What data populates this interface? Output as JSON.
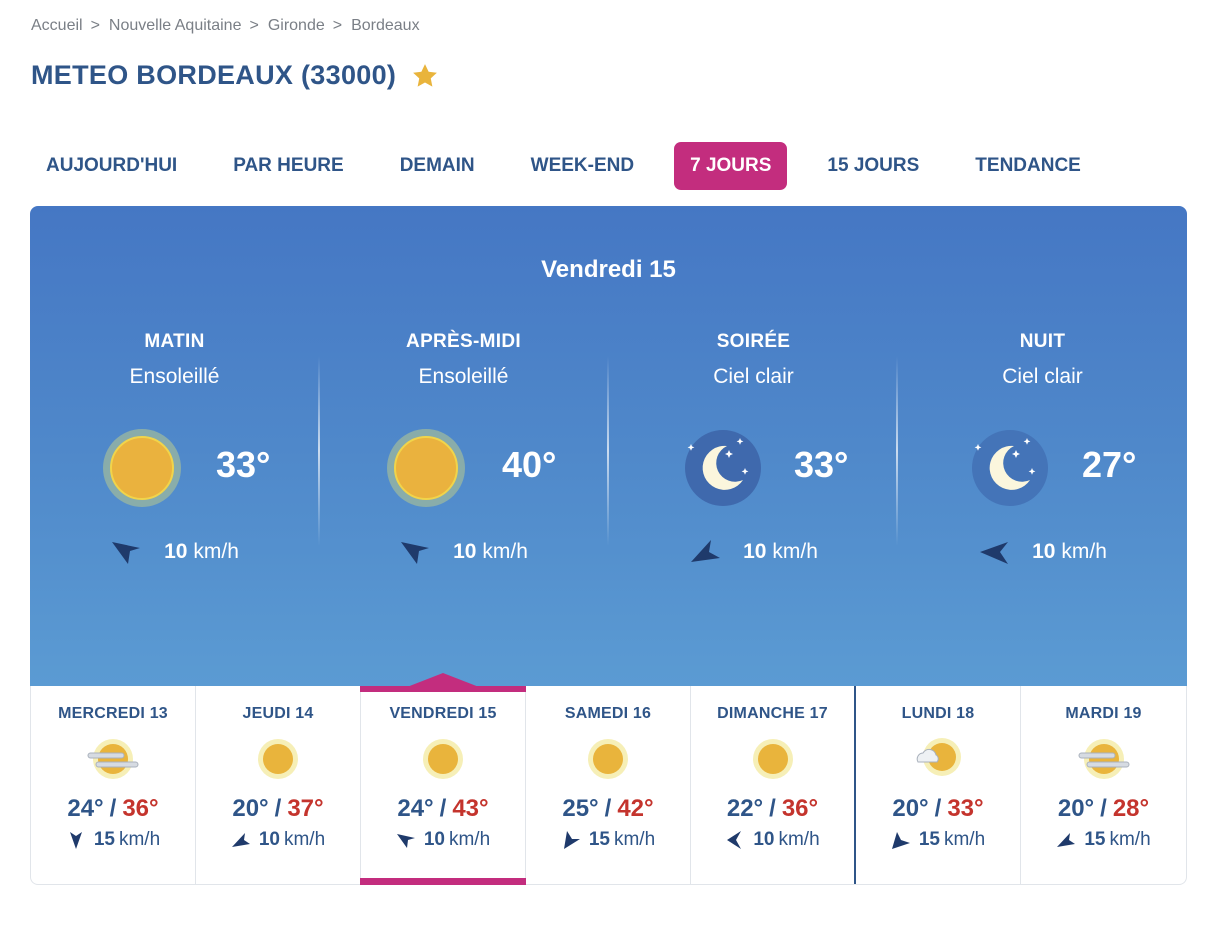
{
  "breadcrumb": [
    "Accueil",
    "Nouvelle Aquitaine",
    "Gironde",
    "Bordeaux"
  ],
  "breadcrumb_separator": ">",
  "title": "METEO BORDEAUX (33000)",
  "tabs": [
    {
      "label": "AUJOURD'HUI",
      "active": false
    },
    {
      "label": "PAR HEURE",
      "active": false
    },
    {
      "label": "DEMAIN",
      "active": false
    },
    {
      "label": "WEEK-END",
      "active": false
    },
    {
      "label": "7 JOURS",
      "active": true
    },
    {
      "label": "15 JOURS",
      "active": false
    },
    {
      "label": "TENDANCE",
      "active": false
    }
  ],
  "hero": {
    "day": "Vendredi 15",
    "periods": [
      {
        "name": "MATIN",
        "desc": "Ensoleillé",
        "icon": "sun-icon",
        "temp": "33°",
        "wind_speed": "10",
        "wind_unit": "km/h",
        "wind_icon": "wind-arrow-southeast-icon"
      },
      {
        "name": "APRÈS-MIDI",
        "desc": "Ensoleillé",
        "icon": "sun-icon",
        "temp": "40°",
        "wind_speed": "10",
        "wind_unit": "km/h",
        "wind_icon": "wind-arrow-southeast-icon"
      },
      {
        "name": "SOIRÉE",
        "desc": "Ciel clair",
        "icon": "moon-stars-icon",
        "temp": "33°",
        "wind_speed": "10",
        "wind_unit": "km/h",
        "wind_icon": "wind-arrow-northeast-icon"
      },
      {
        "name": "NUIT",
        "desc": "Ciel clair",
        "icon": "moon-stars-icon",
        "temp": "27°",
        "wind_speed": "10",
        "wind_unit": "km/h",
        "wind_icon": "wind-arrow-east-icon"
      }
    ]
  },
  "days": [
    {
      "name": "MERCREDI 13",
      "icon": "sun-haze-icon",
      "min": "24°",
      "max": "36°",
      "wind_speed": "15",
      "wind_unit": "km/h"
    },
    {
      "name": "JEUDI 14",
      "icon": "sun-icon",
      "min": "20°",
      "max": "37°",
      "wind_speed": "10",
      "wind_unit": "km/h"
    },
    {
      "name": "VENDREDI 15",
      "icon": "sun-icon",
      "min": "24°",
      "max": "43°",
      "wind_speed": "10",
      "wind_unit": "km/h",
      "selected": true
    },
    {
      "name": "SAMEDI 16",
      "icon": "sun-icon",
      "min": "25°",
      "max": "42°",
      "wind_speed": "15",
      "wind_unit": "km/h"
    },
    {
      "name": "DIMANCHE 17",
      "icon": "sun-icon",
      "min": "22°",
      "max": "36°",
      "wind_speed": "10",
      "wind_unit": "km/h"
    },
    {
      "name": "LUNDI 18",
      "icon": "sun-cloud-icon",
      "min": "20°",
      "max": "33°",
      "wind_speed": "15",
      "wind_unit": "km/h"
    },
    {
      "name": "MARDI 19",
      "icon": "sun-haze-icon",
      "min": "20°",
      "max": "28°",
      "wind_speed": "15",
      "wind_unit": "km/h"
    }
  ],
  "temp_separator": "/",
  "colors": {
    "accent": "#c32d7e",
    "title": "#2f5588",
    "max_temp": "#c4342d",
    "sun": "#e9b43c"
  }
}
